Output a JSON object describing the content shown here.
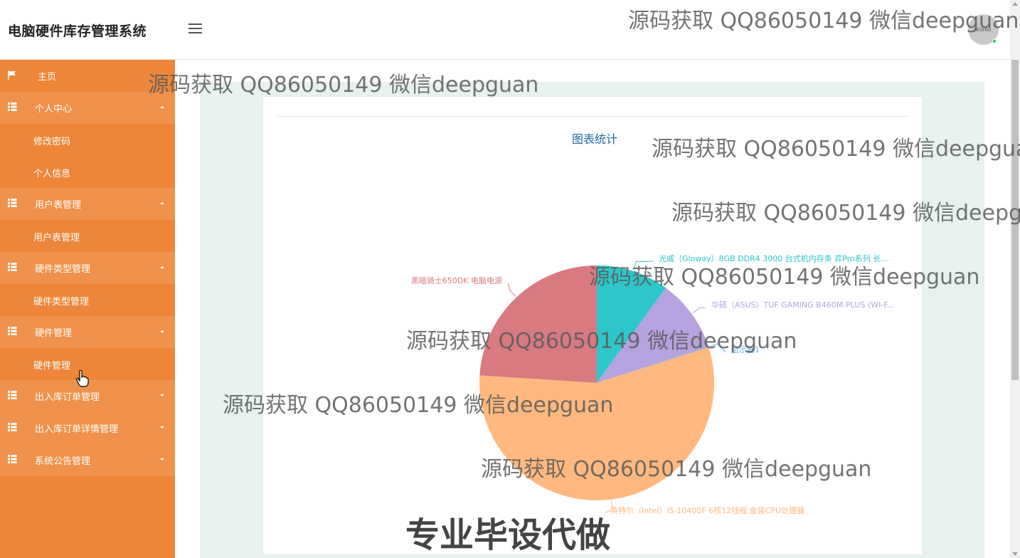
{
  "header": {
    "title": "电脑硬件库存管理系统",
    "avatar_text": "80x80"
  },
  "sidebar": {
    "items": [
      {
        "label": "主页",
        "type": "top"
      },
      {
        "label": "个人中心",
        "type": "group",
        "arrow": "up"
      },
      {
        "label": "修改密码",
        "type": "sub"
      },
      {
        "label": "个人信息",
        "type": "sub"
      },
      {
        "label": "用户表管理",
        "type": "group",
        "arrow": "up"
      },
      {
        "label": "用户表管理",
        "type": "sub"
      },
      {
        "label": "硬件类型管理",
        "type": "group",
        "arrow": "up"
      },
      {
        "label": "硬件类型管理",
        "type": "sub"
      },
      {
        "label": "硬件管理",
        "type": "group",
        "arrow": "up"
      },
      {
        "label": "硬件管理",
        "type": "sub"
      },
      {
        "label": "出入库订单管理",
        "type": "group",
        "arrow": "down"
      },
      {
        "label": "出入库订单详情管理",
        "type": "group",
        "arrow": "down"
      },
      {
        "label": "系统公告管理",
        "type": "group",
        "arrow": "down"
      }
    ]
  },
  "main": {
    "chart_title": "图表统计"
  },
  "chart_data": {
    "type": "pie",
    "slices": [
      {
        "name": "光威（Gloway）8GB DDR4 3000 台式机内存条 弈Pro系列 长...",
        "value": 1,
        "color": "#2ec7c9"
      },
      {
        "name": "华硕（ASUS）TUF GAMING B460M-PLUS (WI-F...",
        "value": 1,
        "color": "#b6a2de"
      },
      {
        "name": "显示器1",
        "value": 0.01,
        "color": "#5ab1ef"
      },
      {
        "name": "英特尔（Intel）i5-10400F 6核12线程 盒装CPU处理器",
        "value": 5.6,
        "color": "#ffb980"
      },
      {
        "name": "黑暗骑士650DK 电脑电源",
        "value": 2.4,
        "color": "#d87a80"
      }
    ]
  },
  "watermarks": {
    "line": "源码获取 QQ86050149 微信deepguan",
    "big": "专业毕设代做"
  }
}
